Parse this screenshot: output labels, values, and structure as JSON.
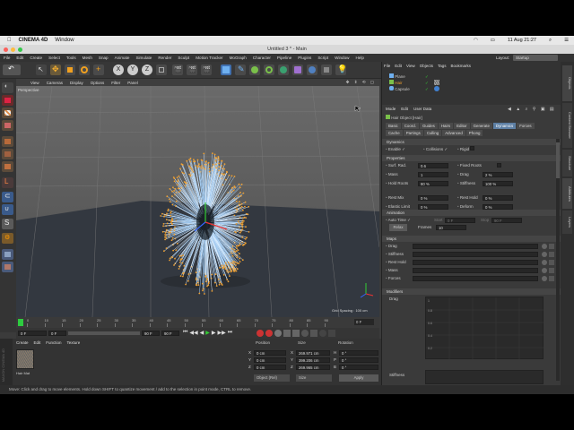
{
  "mac_menubar": {
    "app_name": "CINEMA 4D",
    "menu": "Window",
    "date_time": "11 Aug 21:27"
  },
  "window": {
    "title": "Untitled 3 * - Main"
  },
  "main_menu": [
    "File",
    "Edit",
    "Create",
    "Select",
    "Tools",
    "Mesh",
    "Snap",
    "Animate",
    "Simulate",
    "Render",
    "Sculpt",
    "Motion Tracker",
    "MoGraph",
    "Character",
    "Pipeline",
    "Plugins",
    "Script",
    "Window",
    "Help"
  ],
  "layout": {
    "label": "Layout:",
    "value": "Startup"
  },
  "axis_buttons": [
    "X",
    "Y",
    "Z"
  ],
  "viewport": {
    "menu": [
      "View",
      "Cameras",
      "Display",
      "Options",
      "Filter",
      "Panel"
    ],
    "label": "Perspective",
    "grid_spacing": "Grid Spacing : 100 cm"
  },
  "timeline": {
    "ticks": [
      "0",
      "10",
      "15",
      "20",
      "25",
      "30",
      "35",
      "40",
      "45",
      "50",
      "55",
      "60",
      "65",
      "70",
      "75",
      "80",
      "85",
      "90"
    ],
    "end_frame": "0 F",
    "current_field": "0 F",
    "start_field": "0 F",
    "end_field": "90 F",
    "max_field": "90 F"
  },
  "material_manager": {
    "menu": [
      "Create",
      "Edit",
      "Function",
      "Texture"
    ],
    "material_name": "Hair Mat"
  },
  "coordinates": {
    "headers": [
      "Position",
      "Size",
      "Rotation"
    ],
    "rows": [
      {
        "axis": "X",
        "pos": "0 cm",
        "size_axis": "X",
        "size": "269.971 cm",
        "rot_axis": "H",
        "rot": "0 °"
      },
      {
        "axis": "Y",
        "pos": "0 cm",
        "size_axis": "Y",
        "size": "399.206 cm",
        "rot_axis": "P",
        "rot": "0 °"
      },
      {
        "axis": "Z",
        "pos": "0 cm",
        "size_axis": "Z",
        "size": "269.965 cm",
        "rot_axis": "B",
        "rot": "0 °"
      }
    ],
    "mode_select": "Object (Rel)",
    "size_select": "Size",
    "apply_label": "Apply"
  },
  "object_manager": {
    "menu": [
      "File",
      "Edit",
      "View",
      "Objects",
      "Tags",
      "Bookmarks"
    ],
    "objects": [
      "Plane",
      "Hair",
      "Capsule"
    ]
  },
  "attribute_manager": {
    "menu": [
      "Mode",
      "Edit",
      "User Data"
    ],
    "object_title": "Hair Object [Hair]",
    "tabs_row1": [
      "Basic",
      "Coord.",
      "Guides",
      "Hairs",
      "Editor",
      "Generate",
      "Dynamics",
      "Forces"
    ],
    "tabs_row2": [
      "Cache",
      "Partings",
      "Culling",
      "Advanced",
      "Phong"
    ],
    "active_tab": "Dynamics",
    "section_dynamics": "Dynamics",
    "enable_label": "Enable",
    "collisions_label": "Collisions",
    "rigid_label": "Rigid",
    "section_properties": "Properties",
    "properties": [
      {
        "l": "Surf. Rad.",
        "v": "0.6",
        "r": "Fixed Roots",
        "rv": ""
      },
      {
        "l": "Mass",
        "v": "1",
        "r": "Drag",
        "rv": "2 %"
      },
      {
        "l": "Hold Roots",
        "v": "80 %",
        "r": "Stiffness",
        "rv": "100 %"
      },
      {
        "l": "Rest Mix",
        "v": "0 %",
        "r": "Rest Hold",
        "rv": "0 %"
      },
      {
        "l": "Elastic Limit",
        "v": "0 %",
        "r": "Deform",
        "rv": "0 %"
      }
    ],
    "section_animation": "Animation",
    "auto_time_label": "Auto Time",
    "start_label": "Start",
    "start_value": "0 F",
    "stop_label": "Stop",
    "stop_value": "90 F",
    "relax_label": "Relax",
    "frames_label": "Frames",
    "frames_value": "10",
    "section_maps": "Maps",
    "maps": [
      "Drag",
      "Stiffness",
      "Rest Hold",
      "Mass",
      "Forces"
    ],
    "section_modifiers": "Modifiers",
    "modifier_drag": "Drag",
    "modifier_stiffness": "Stiffness",
    "graph_ticks_y": [
      "0.8",
      "0.6",
      "0.4",
      "0.2"
    ],
    "graph_tick_1": "1"
  },
  "right_tabs": [
    "Objects",
    "Content Browser",
    "Structure",
    "Attributes",
    "Layers"
  ],
  "status_bar": "Move: Click and drag to move elements. Hold down SHIFT to quantize movement / add to the selection in point mode, CTRL to remove."
}
